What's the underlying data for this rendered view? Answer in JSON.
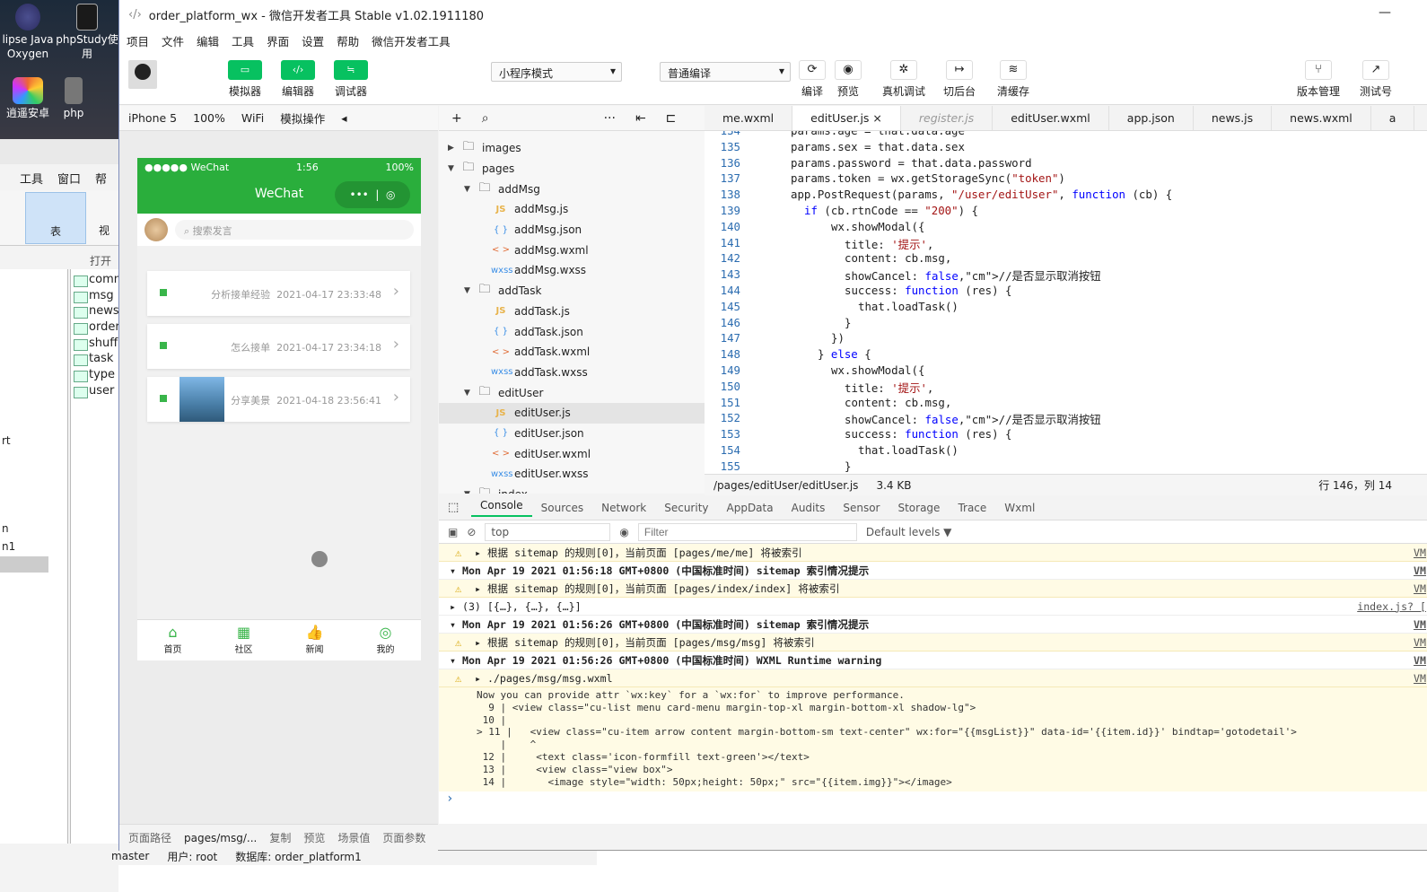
{
  "desktop": {
    "icons": [
      {
        "label": "lipse Java Oxygen",
        "icon": "eclipse-icon"
      },
      {
        "label": "phpStudy使用",
        "icon": "phpstudy-icon"
      },
      {
        "label": "逍遥安卓",
        "icon": "memu-android-icon"
      },
      {
        "label": "php",
        "icon": "php-icon"
      }
    ],
    "bg_app": {
      "menu": [
        "工具",
        "窗口",
        "帮"
      ],
      "table_button": "表",
      "view_button": "视",
      "open_label": "打开表",
      "tables": [
        "comm",
        "msg",
        "news",
        "order",
        "shuff",
        "task",
        "type",
        "user"
      ],
      "side_labels": [
        "rt",
        "n",
        "n1"
      ],
      "status": {
        "branch": "master",
        "user": "用户: root",
        "db": "数据库: order_platform1"
      }
    }
  },
  "ide": {
    "title": "order_platform_wx - 微信开发者工具 Stable v1.02.1911180",
    "menu": [
      "项目",
      "文件",
      "编辑",
      "工具",
      "界面",
      "设置",
      "帮助",
      "微信开发者工具"
    ],
    "toolbar": {
      "simulator": "模拟器",
      "editor": "编辑器",
      "debugger": "调试器",
      "mode": "小程序模式",
      "compile_mode": "普通编译",
      "compile": "编译",
      "preview": "预览",
      "remote_debug": "真机调试",
      "background": "切后台",
      "clear_cache": "清缓存",
      "version": "版本管理",
      "test": "测试号"
    },
    "sim_bar": {
      "device": "iPhone 5",
      "zoom": "100%",
      "network": "WiFi",
      "ops": "模拟操作"
    },
    "phone": {
      "carrier": "●●●●● WeChat",
      "time": "1:56",
      "battery": "100%",
      "nav_title": "WeChat",
      "capsule": "•••",
      "search_placeholder": "搜索发言",
      "cards": [
        {
          "title": "分析接单经验",
          "time": "2021-04-17 23:33:48"
        },
        {
          "title": "怎么接单",
          "time": "2021-04-17 23:34:18"
        },
        {
          "title": "分享美景",
          "time": "2021-04-18 23:56:41"
        }
      ],
      "tabs": [
        "首页",
        "社区",
        "新闻",
        "我的"
      ]
    },
    "sim_footer": [
      "页面路径",
      "pages/msg/...",
      "复制",
      "预览",
      "场景值",
      "页面参数"
    ],
    "filetree": [
      {
        "name": "images",
        "type": "folder",
        "depth": 0,
        "open": false
      },
      {
        "name": "pages",
        "type": "folder",
        "depth": 0,
        "open": true
      },
      {
        "name": "addMsg",
        "type": "folder",
        "depth": 1,
        "open": true
      },
      {
        "name": "addMsg.js",
        "type": "js",
        "depth": 2
      },
      {
        "name": "addMsg.json",
        "type": "json",
        "depth": 2
      },
      {
        "name": "addMsg.wxml",
        "type": "wxml",
        "depth": 2
      },
      {
        "name": "addMsg.wxss",
        "type": "wxss",
        "depth": 2
      },
      {
        "name": "addTask",
        "type": "folder",
        "depth": 1,
        "open": true
      },
      {
        "name": "addTask.js",
        "type": "js",
        "depth": 2
      },
      {
        "name": "addTask.json",
        "type": "json",
        "depth": 2
      },
      {
        "name": "addTask.wxml",
        "type": "wxml",
        "depth": 2
      },
      {
        "name": "addTask.wxss",
        "type": "wxss",
        "depth": 2
      },
      {
        "name": "editUser",
        "type": "folder",
        "depth": 1,
        "open": true
      },
      {
        "name": "editUser.js",
        "type": "js",
        "depth": 2,
        "selected": true
      },
      {
        "name": "editUser.json",
        "type": "json",
        "depth": 2
      },
      {
        "name": "editUser.wxml",
        "type": "wxml",
        "depth": 2
      },
      {
        "name": "editUser.wxss",
        "type": "wxss",
        "depth": 2
      },
      {
        "name": "index",
        "type": "folder",
        "depth": 1,
        "open": true
      }
    ],
    "editor_tabs": [
      {
        "label": "me.wxml"
      },
      {
        "label": "editUser.js",
        "active": true,
        "close": "×"
      },
      {
        "label": "register.js",
        "italic": true
      },
      {
        "label": "editUser.wxml"
      },
      {
        "label": "app.json"
      },
      {
        "label": "news.js"
      },
      {
        "label": "news.wxml"
      },
      {
        "label": "a"
      }
    ],
    "code": [
      {
        "n": "134",
        "t": "params.age = that.data.age",
        "i": 2
      },
      {
        "n": "135",
        "t": "params.sex = that.data.sex",
        "i": 2
      },
      {
        "n": "136",
        "t": "params.password = that.data.password",
        "i": 2
      },
      {
        "n": "137",
        "t": "params.token = wx.getStorageSync(\"token\")",
        "i": 2
      },
      {
        "n": "138",
        "t": "app.PostRequest(params, \"/user/editUser\", function (cb) {",
        "i": 2
      },
      {
        "n": "139",
        "t": "if (cb.rtnCode == \"200\") {",
        "i": 3
      },
      {
        "n": "140",
        "t": "wx.showModal({",
        "i": 5
      },
      {
        "n": "141",
        "t": "title: '提示',",
        "i": 6
      },
      {
        "n": "142",
        "t": "content: cb.msg,",
        "i": 6
      },
      {
        "n": "143",
        "t": "showCancel: false,//是否显示取消按钮",
        "i": 6
      },
      {
        "n": "144",
        "t": "success: function (res) {",
        "i": 6
      },
      {
        "n": "145",
        "t": "that.loadTask()",
        "i": 7
      },
      {
        "n": "146",
        "t": "}",
        "i": 6
      },
      {
        "n": "147",
        "t": "})",
        "i": 5
      },
      {
        "n": "148",
        "t": "} else {",
        "i": 4
      },
      {
        "n": "149",
        "t": "wx.showModal({",
        "i": 5
      },
      {
        "n": "150",
        "t": "title: '提示',",
        "i": 6
      },
      {
        "n": "151",
        "t": "content: cb.msg,",
        "i": 6
      },
      {
        "n": "152",
        "t": "showCancel: false,//是否显示取消按钮",
        "i": 6
      },
      {
        "n": "153",
        "t": "success: function (res) {",
        "i": 6
      },
      {
        "n": "154",
        "t": "that.loadTask()",
        "i": 7
      },
      {
        "n": "155",
        "t": "}",
        "i": 6
      }
    ],
    "editor_status": {
      "path": "/pages/editUser/editUser.js",
      "size": "3.4 KB",
      "cursor": "行 146，列 14"
    },
    "dev_tabs": [
      "Console",
      "Sources",
      "Network",
      "Security",
      "AppData",
      "Audits",
      "Sensor",
      "Storage",
      "Trace",
      "Wxml"
    ],
    "dev_filter": {
      "context": "top",
      "placeholder": "Filter",
      "levels": "Default levels ▼"
    },
    "console": [
      {
        "type": "warn",
        "text": "▸ 根据 sitemap 的规则[0]，当前页面 [pages/me/me] 将被索引",
        "src": "VM"
      },
      {
        "type": "group",
        "text": "▾ Mon Apr 19 2021 01:56:18 GMT+0800 (中国标准时间) sitemap 索引情况提示",
        "src": "VM"
      },
      {
        "type": "warn",
        "text": "▸ 根据 sitemap 的规则[0]，当前页面 [pages/index/index] 将被索引",
        "src": "VM"
      },
      {
        "type": "log",
        "text": "▸ (3) [{…}, {…}, {…}]",
        "src": "index.js? ["
      },
      {
        "type": "group",
        "text": "▾ Mon Apr 19 2021 01:56:26 GMT+0800 (中国标准时间) sitemap 索引情况提示",
        "src": "VM"
      },
      {
        "type": "warn",
        "text": "▸ 根据 sitemap 的规则[0]，当前页面 [pages/msg/msg] 将被索引",
        "src": "VM"
      },
      {
        "type": "group",
        "text": "▾ Mon Apr 19 2021 01:56:26 GMT+0800 (中国标准时间) WXML Runtime warning",
        "src": "VM"
      },
      {
        "type": "warn",
        "text": "▸ ./pages/msg/msg.wxml",
        "src": "VM"
      }
    ],
    "warning_block": "Now you can provide attr `wx:key` for a `wx:for` to improve performance.\n  9 | <view class=\"cu-list menu card-menu margin-top-xl margin-bottom-xl shadow-lg\">\n 10 |\n> 11 |   <view class=\"cu-item arrow content margin-bottom-sm text-center\" wx:for=\"{{msgList}}\" data-id='{{item.id}}' bindtap='gotodetail'>\n    |    ^\n 12 |     <text class='icon-formfill text-green'></text>\n 13 |     <view class=\"view box\">\n 14 |       <image style=\"width: 50px;height: 50px;\" src=\"{{item.img}}\"></image>",
    "prompt": "›"
  }
}
